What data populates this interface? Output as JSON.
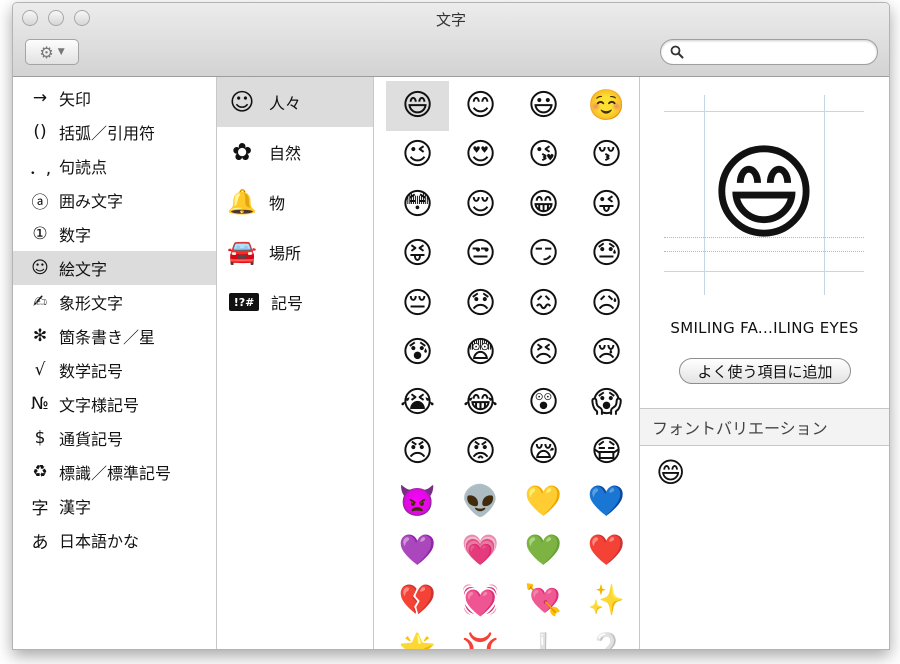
{
  "window": {
    "title": "文字"
  },
  "toolbar": {
    "gear_icon": "gear-icon",
    "search": {
      "value": "",
      "placeholder": ""
    }
  },
  "categories": [
    {
      "glyph": "→",
      "label": "矢印"
    },
    {
      "glyph": "()",
      "label": "括弧／引用符"
    },
    {
      "glyph": "．,",
      "label": "句読点"
    },
    {
      "glyph": "ⓐ",
      "label": "囲み文字"
    },
    {
      "glyph": "①",
      "label": "数字"
    },
    {
      "glyph": "☺",
      "label": "絵文字",
      "selected": true
    },
    {
      "glyph": "✍",
      "label": "象形文字"
    },
    {
      "glyph": "✻",
      "label": "箇条書き／星"
    },
    {
      "glyph": "√",
      "label": "数学記号"
    },
    {
      "glyph": "№",
      "label": "文字様記号"
    },
    {
      "glyph": "$",
      "label": "通貨記号"
    },
    {
      "glyph": "♻",
      "label": "標識／標準記号"
    },
    {
      "glyph": "字",
      "label": "漢字"
    },
    {
      "glyph": "あ",
      "label": "日本語かな"
    }
  ],
  "subcategories": [
    {
      "icon": "smiley-face-icon",
      "glyph": "☺",
      "label": "人々",
      "selected": true
    },
    {
      "icon": "flower-icon",
      "glyph": "✿",
      "label": "自然"
    },
    {
      "icon": "bell-icon",
      "glyph": "🔔",
      "label": "物"
    },
    {
      "icon": "car-icon",
      "glyph": "🚘",
      "label": "場所"
    },
    {
      "icon": "symbols-icon",
      "glyph": "!?#",
      "label": "記号"
    }
  ],
  "emojis": [
    "😄",
    "😊",
    "😃",
    "☺️",
    "😉",
    "😍",
    "😘",
    "😚",
    "😳",
    "😌",
    "😁",
    "😜",
    "😝",
    "😒",
    "😏",
    "😓",
    "😔",
    "😞",
    "😖",
    "😥",
    "😰",
    "😨",
    "😣",
    "😢",
    "😭",
    "😂",
    "😲",
    "😱",
    "😠",
    "😡",
    "😪",
    "😷",
    "👿",
    "👽",
    "💛",
    "💙",
    "💜",
    "💗",
    "💚",
    "❤️",
    "💔",
    "💓",
    "💘",
    "✨",
    "🌟",
    "💢",
    "❕",
    "❔"
  ],
  "selected_emoji_index": 0,
  "detail": {
    "preview": "😄",
    "name": "SMILING FA...ILING EYES",
    "add_favorite_label": "よく使う項目に追加",
    "font_variations_label": "フォントバリエーション",
    "variations": [
      "😄"
    ]
  }
}
